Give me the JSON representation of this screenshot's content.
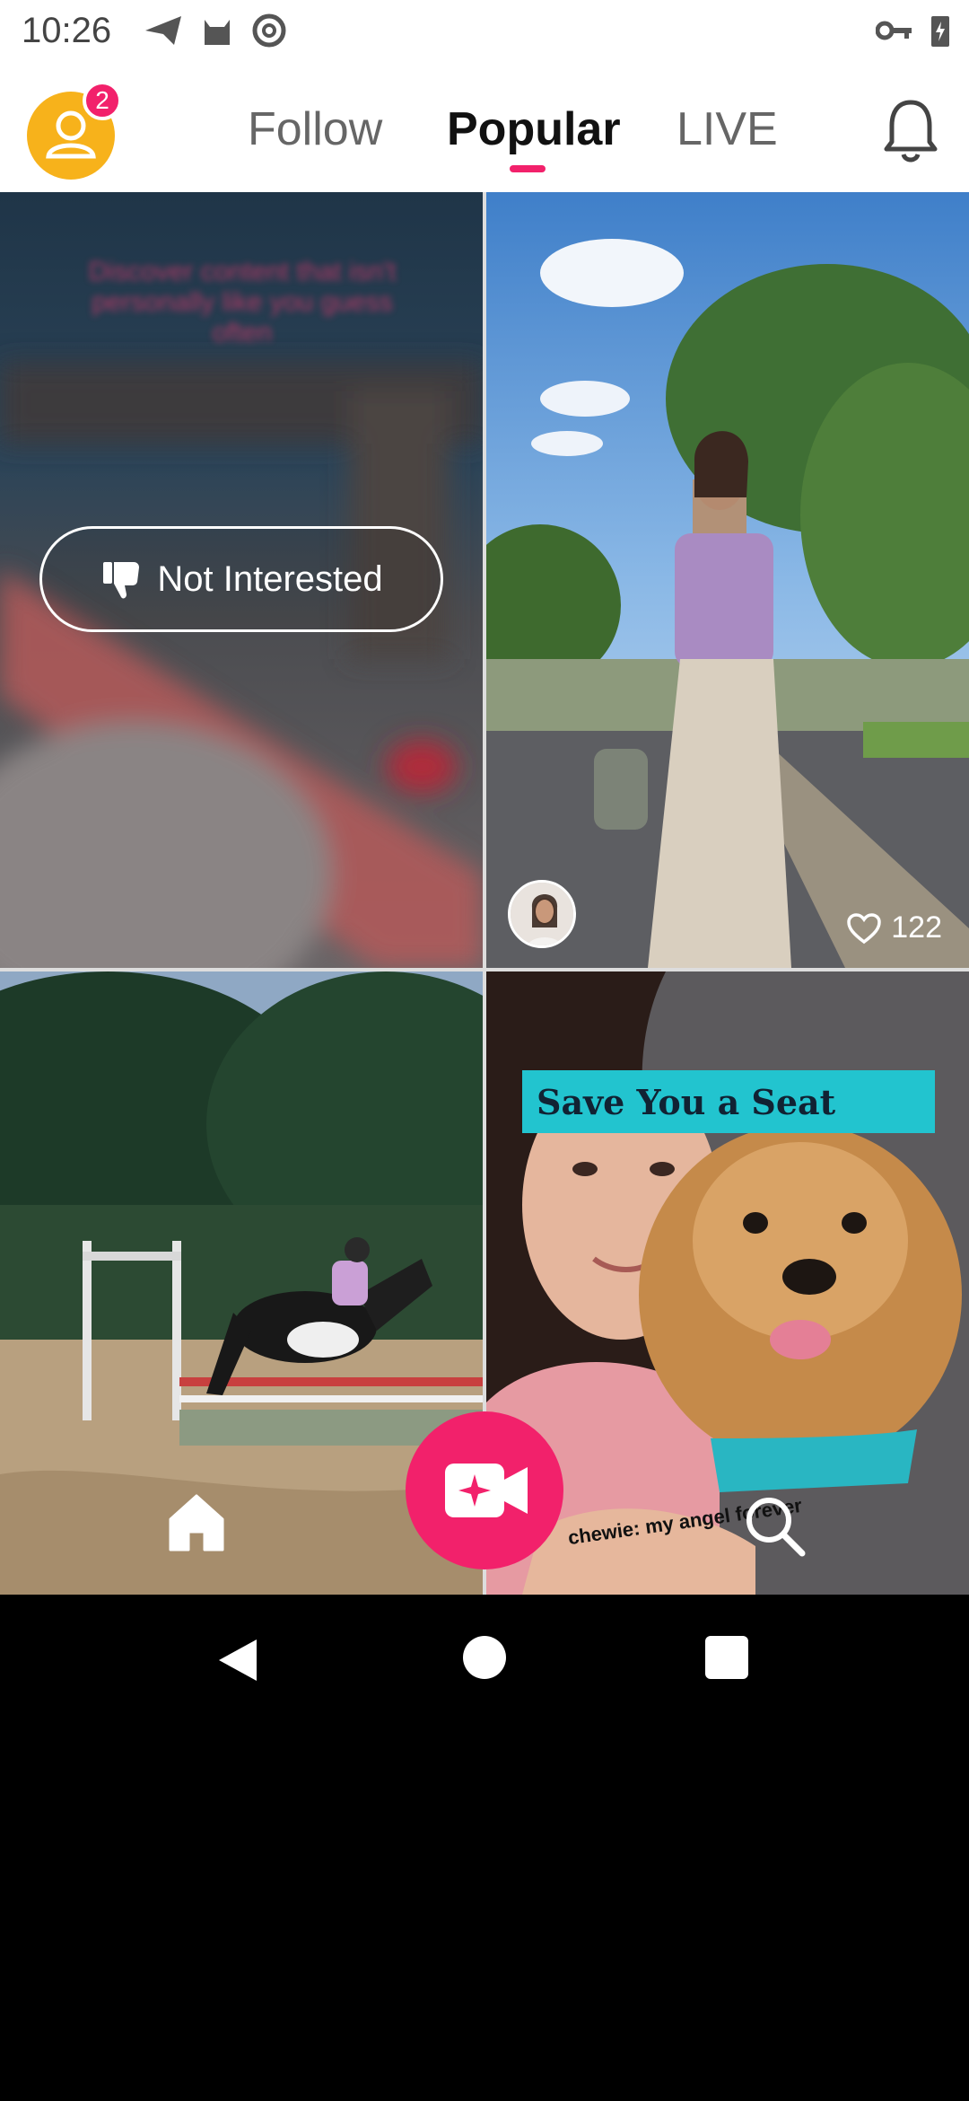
{
  "status_bar": {
    "time": "10:26",
    "left_icons": [
      "send-icon",
      "cat-icon",
      "at-sign-icon"
    ],
    "right_icons": [
      "key-icon",
      "battery-charging-icon"
    ]
  },
  "header": {
    "profile_badge": "2",
    "tabs": [
      {
        "label": "Follow",
        "active": false
      },
      {
        "label": "Popular",
        "active": true
      },
      {
        "label": "LIVE",
        "active": false
      }
    ],
    "notifications_icon": "bell-icon",
    "accent_color": "#f2216b"
  },
  "feed": {
    "items": [
      {
        "kind": "hidden",
        "blurred_text": "Discover content that isn't personally like you guess often",
        "action_label": "Not Interested",
        "action_icon": "thumbs-down-icon"
      },
      {
        "kind": "video",
        "likes": "122",
        "like_icon": "heart-outline-icon"
      },
      {
        "kind": "video",
        "scene": "horse-jumping"
      },
      {
        "kind": "video",
        "banner_text": "Save You a Seat",
        "caption": "chewie: my angel forever"
      }
    ]
  },
  "bottom_nav": {
    "home_icon": "home-icon",
    "record_icon": "video-camera-icon",
    "search_icon": "search-icon"
  },
  "system_nav": {
    "back_icon": "back-triangle-icon",
    "home_icon": "home-circle-icon",
    "recents_icon": "recents-square-icon"
  }
}
